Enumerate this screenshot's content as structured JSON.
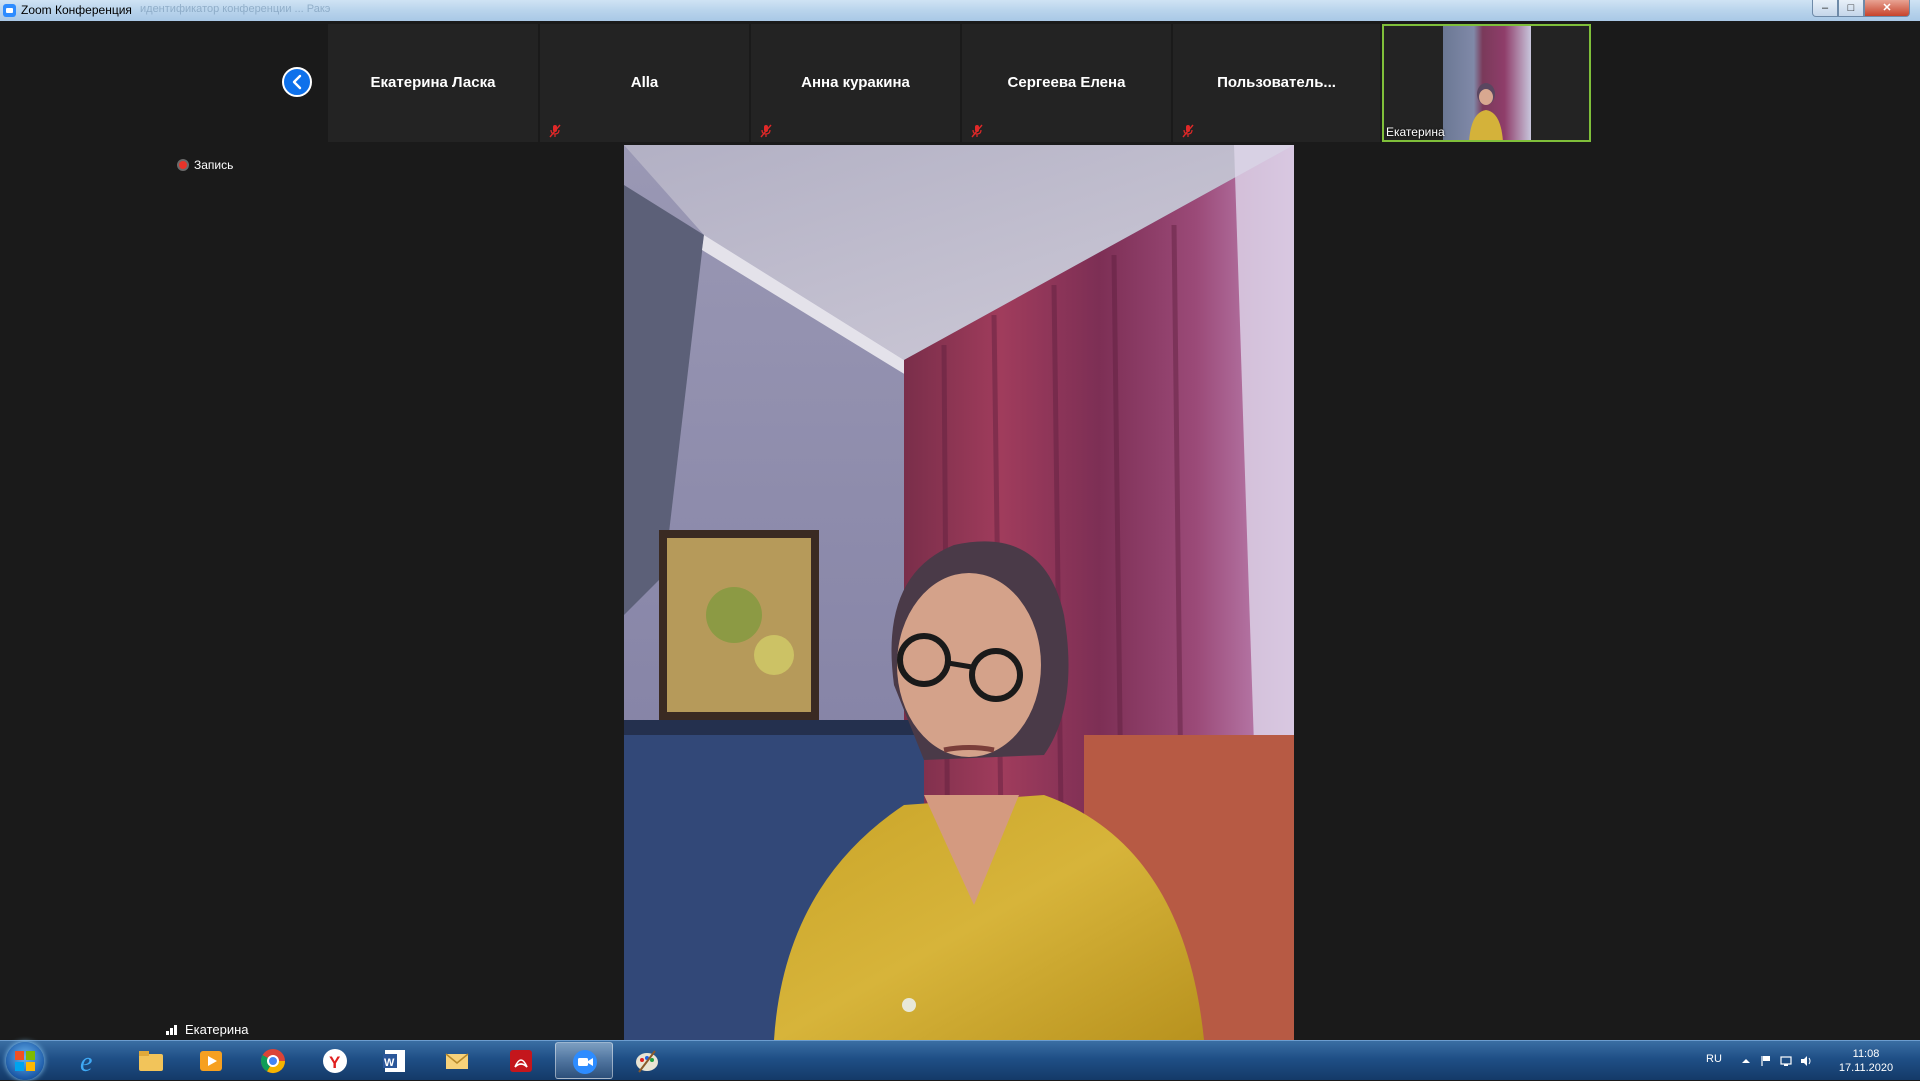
{
  "window": {
    "title": "Zoom Конференция",
    "ghost_text": "идентификатор конференции ...   Ракэ",
    "controls": {
      "minimize": "–",
      "maximize": "□",
      "close": "✕"
    }
  },
  "participants": [
    {
      "name": "Екатерина Ласка",
      "muted": false
    },
    {
      "name": "Alla",
      "muted": true
    },
    {
      "name": "Анна куракина",
      "muted": true
    },
    {
      "name": "Сергеева Елена",
      "muted": true
    },
    {
      "name": "Пользователь...",
      "muted": true
    }
  ],
  "self_tile": {
    "label": "Екатерина"
  },
  "recording": {
    "label": "Запись"
  },
  "active_speaker": {
    "label": "Екатерина"
  },
  "taskbar": {
    "apps": [
      "windows-start",
      "internet-explorer",
      "file-explorer",
      "media-player",
      "chrome",
      "yandex-browser",
      "word",
      "outlook",
      "acrobat-reader",
      "zoom",
      "paint"
    ],
    "language": "RU",
    "time": "11:08",
    "date": "17.11.2020"
  },
  "colors": {
    "background": "#1a1a1a",
    "tile": "#232323",
    "accent_blue": "#0e71eb",
    "self_border": "#7fbf3a",
    "record_red": "#e8342a",
    "mute_red": "#e02828"
  }
}
